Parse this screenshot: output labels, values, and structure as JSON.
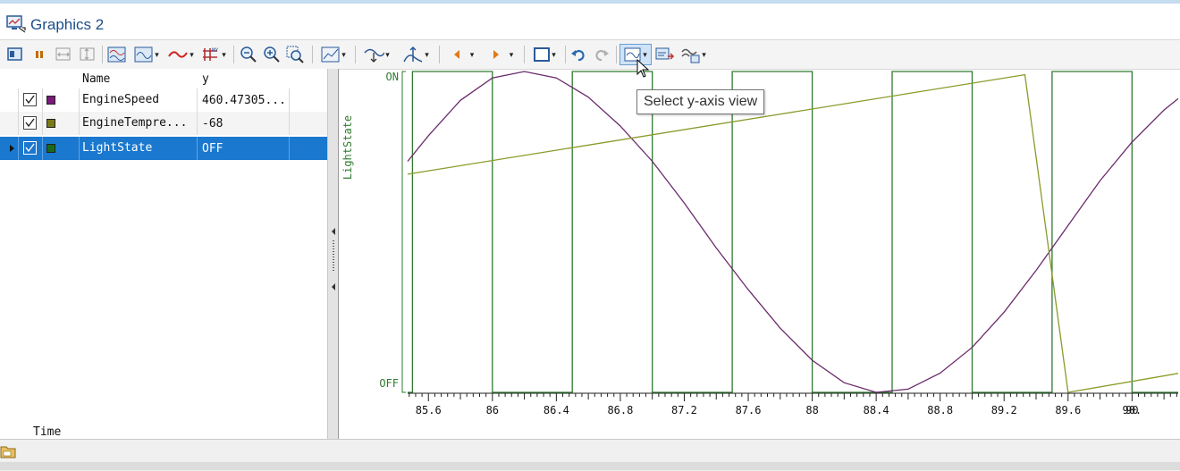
{
  "window": {
    "title": "Graphics 2"
  },
  "signals": {
    "header": {
      "name": "Name",
      "value": "y"
    },
    "rows": [
      {
        "name": "EngineSpeed",
        "value": "460.47305...",
        "color": "#7a1a7a",
        "checked": true,
        "selected": false
      },
      {
        "name": "EngineTempre...",
        "value": "-68",
        "color": "#7a7a1a",
        "checked": true,
        "selected": false
      },
      {
        "name": "LightState",
        "value": "OFF",
        "color": "#1a6a1a",
        "checked": true,
        "selected": true
      }
    ],
    "time_label": "Time"
  },
  "tooltip": {
    "text": "Select y-axis view"
  },
  "toolbar": {
    "icons": [
      "measurement-marker-icon",
      "pause-icon",
      "fit-x-icon",
      "fit-y-icon",
      "signal-layout-icon",
      "signal-layout-menu-icon",
      "line-style-icon",
      "scaling-menu-icon",
      "zoom-out-icon",
      "zoom-in-icon",
      "zoom-region-icon",
      "scale-menu-icon",
      "cursor-menu-icon",
      "difference-cursor-icon",
      "prev-marker-icon",
      "next-marker-icon",
      "background-menu-icon",
      "undo-icon",
      "redo-icon",
      "y-axis-view-icon",
      "export-icon",
      "graph-settings-icon"
    ]
  },
  "chart_data": {
    "type": "line",
    "ylabel": "LightState",
    "y_ticks": [
      "ON",
      "OFF"
    ],
    "x_ticks": [
      "85.6",
      "86",
      "86.4",
      "86.8",
      "87.2",
      "87.6",
      "88",
      "88.4",
      "88.8",
      "89.2",
      "89.6",
      "90",
      "90."
    ],
    "xlim": [
      85.47,
      90.3
    ],
    "colors": {
      "EngineSpeed": "#6b2a6b",
      "EngineTempre": "#8a9a2a",
      "LightState": "#2f7a2f"
    },
    "series": [
      {
        "name": "LightState",
        "x": [
          85.47,
          85.5,
          85.5,
          86.0,
          86.0,
          86.5,
          86.5,
          87.0,
          87.0,
          87.5,
          87.5,
          88.0,
          88.0,
          88.5,
          88.5,
          89.0,
          89.0,
          89.5,
          89.5,
          90.0,
          90.0,
          90.3
        ],
        "y": [
          0,
          0,
          1,
          1,
          0,
          0,
          1,
          1,
          0,
          0,
          1,
          1,
          0,
          0,
          1,
          1,
          0,
          0,
          1,
          1,
          0,
          0
        ],
        "y_labels": [
          "OFF",
          "ON"
        ]
      },
      {
        "name": "EngineSpeed",
        "x": [
          85.47,
          85.6,
          85.8,
          86.0,
          86.2,
          86.4,
          86.6,
          86.8,
          87.0,
          87.2,
          87.4,
          87.6,
          87.8,
          88.0,
          88.2,
          88.4,
          88.6,
          88.8,
          89.0,
          89.2,
          89.4,
          89.6,
          89.8,
          90.0,
          90.2,
          90.3
        ],
        "y": [
          0.72,
          0.8,
          0.91,
          0.98,
          1.0,
          0.98,
          0.92,
          0.83,
          0.72,
          0.59,
          0.45,
          0.32,
          0.2,
          0.1,
          0.03,
          0.0,
          0.01,
          0.06,
          0.14,
          0.25,
          0.38,
          0.52,
          0.66,
          0.78,
          0.88,
          0.92
        ]
      },
      {
        "name": "EngineTempre",
        "x": [
          85.47,
          89.33,
          89.6,
          90.3
        ],
        "y": [
          0.68,
          0.99,
          0.0,
          0.06
        ]
      }
    ]
  }
}
